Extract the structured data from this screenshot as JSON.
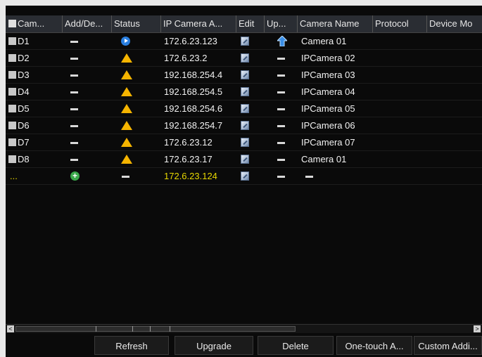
{
  "columns": [
    "Cam...",
    "Add/De...",
    "Status",
    "IP Camera A...",
    "Edit",
    "Up...",
    "Camera Name",
    "Protocol",
    "Device Mo"
  ],
  "rows": [
    {
      "camera": "D1",
      "add_delete": "dash",
      "status": "play",
      "ip": "172.6.23.123",
      "edit": "edit",
      "upgrade": "upgrade-arrow",
      "name": "Camera 01",
      "protocol": "",
      "model": ""
    },
    {
      "camera": "D2",
      "add_delete": "dash",
      "status": "warning",
      "ip": "172.6.23.2",
      "edit": "edit",
      "upgrade": "dash",
      "name": "IPCamera 02",
      "protocol": "",
      "model": ""
    },
    {
      "camera": "D3",
      "add_delete": "dash",
      "status": "warning",
      "ip": "192.168.254.4",
      "edit": "edit",
      "upgrade": "dash",
      "name": "IPCamera 03",
      "protocol": "",
      "model": ""
    },
    {
      "camera": "D4",
      "add_delete": "dash",
      "status": "warning",
      "ip": "192.168.254.5",
      "edit": "edit",
      "upgrade": "dash",
      "name": "IPCamera 04",
      "protocol": "",
      "model": ""
    },
    {
      "camera": "D5",
      "add_delete": "dash",
      "status": "warning",
      "ip": "192.168.254.6",
      "edit": "edit",
      "upgrade": "dash",
      "name": "IPCamera 05",
      "protocol": "",
      "model": ""
    },
    {
      "camera": "D6",
      "add_delete": "dash",
      "status": "warning",
      "ip": "192.168.254.7",
      "edit": "edit",
      "upgrade": "dash",
      "name": "IPCamera 06",
      "protocol": "",
      "model": ""
    },
    {
      "camera": "D7",
      "add_delete": "dash",
      "status": "warning",
      "ip": "172.6.23.12",
      "edit": "edit",
      "upgrade": "dash",
      "name": "IPCamera 07",
      "protocol": "",
      "model": ""
    },
    {
      "camera": "D8",
      "add_delete": "dash",
      "status": "warning",
      "ip": "172.6.23.17",
      "edit": "edit",
      "upgrade": "dash",
      "name": "Camera 01",
      "protocol": "",
      "model": ""
    }
  ],
  "new_row": {
    "camera": "...",
    "add_delete": "add",
    "status": "dash",
    "ip": "172.6.23.124",
    "edit": "edit",
    "upgrade": "dash",
    "name": "dash"
  },
  "buttons": {
    "refresh": "Refresh",
    "upgrade": "Upgrade",
    "delete": "Delete",
    "one_touch": "One-touch A...",
    "custom_add": "Custom Addi..."
  },
  "scroll": {
    "left_arrow": "<",
    "right_arrow": ">"
  },
  "colors": {
    "warning": "#f5b400",
    "online": "#2a7fe0",
    "add": "#3aa84a",
    "new_row_text": "#e8d800"
  }
}
